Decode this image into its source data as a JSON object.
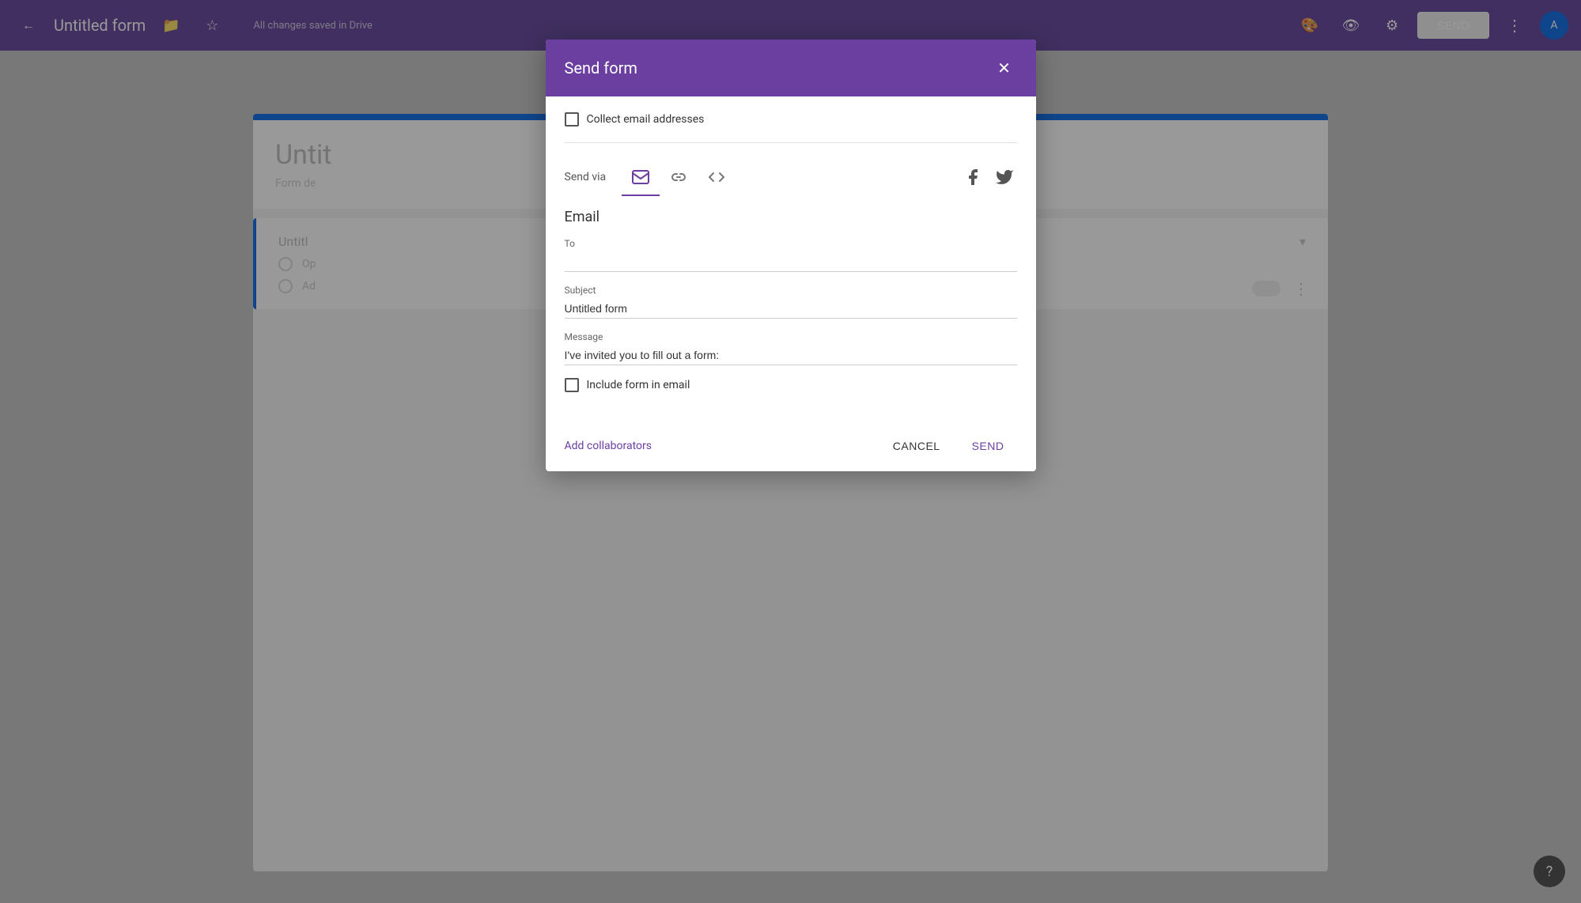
{
  "topbar": {
    "back_icon": "←",
    "title": "Untitled form",
    "folder_icon": "📁",
    "star_icon": "☆",
    "saved_text": "All changes saved in Drive",
    "palette_icon": "🎨",
    "eye_icon": "👁",
    "gear_icon": "⚙",
    "send_label": "SEND",
    "more_icon": "⋮",
    "avatar_text": "A"
  },
  "background": {
    "form_title": "Untit",
    "form_desc": "Form de",
    "question_title": "Untitl",
    "option1": "Op",
    "option2": "Ad"
  },
  "dialog": {
    "title": "Send form",
    "close_icon": "✕",
    "collect_email_label": "Collect email addresses",
    "send_via_label": "Send via",
    "email_section_title": "Email",
    "to_label": "To",
    "to_placeholder": "",
    "subject_label": "Subject",
    "subject_value": "Untitled form",
    "message_label": "Message",
    "message_value": "I've invited you to fill out a form:",
    "include_label": "Include form in email",
    "add_collaborators_label": "Add collaborators",
    "cancel_label": "CANCEL",
    "send_label": "SEND",
    "tabs": [
      {
        "id": "email",
        "icon": "✉",
        "active": true
      },
      {
        "id": "link",
        "icon": "🔗",
        "active": false
      },
      {
        "id": "embed",
        "icon": "<>",
        "active": false
      }
    ],
    "social": {
      "facebook_icon": "f",
      "twitter_icon": "t"
    }
  },
  "help": {
    "icon": "?"
  }
}
